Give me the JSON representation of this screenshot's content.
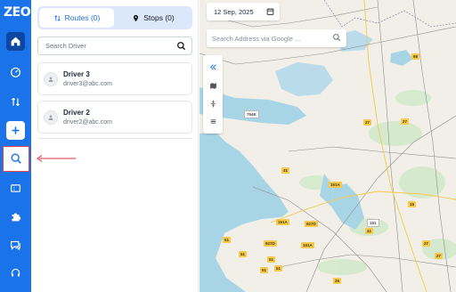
{
  "app": {
    "logo": "ZEO"
  },
  "sidebar": {
    "items": [
      {
        "name": "home",
        "icon": "home-icon"
      },
      {
        "name": "dashboard",
        "icon": "gauge-icon"
      },
      {
        "name": "routes",
        "icon": "route-icon"
      },
      {
        "name": "add",
        "icon": "plus-icon"
      },
      {
        "name": "search",
        "icon": "search-icon"
      },
      {
        "name": "tickets",
        "icon": "ticket-icon"
      },
      {
        "name": "integrations",
        "icon": "puzzle-icon"
      },
      {
        "name": "messages",
        "icon": "chat-icon"
      },
      {
        "name": "support",
        "icon": "headset-icon"
      }
    ]
  },
  "panel": {
    "tabs": [
      {
        "label": "Routes (0)",
        "icon": "route-icon",
        "active": true
      },
      {
        "label": "Stops (0)",
        "icon": "pin-icon",
        "active": false
      }
    ],
    "search_placeholder": "Search Driver",
    "drivers": [
      {
        "name": "Driver 3",
        "email": "driver3@abc.com"
      },
      {
        "name": "Driver 2",
        "email": "driver2@abc.com"
      }
    ]
  },
  "map": {
    "date": "12 Sep, 2025",
    "address_placeholder": "Search Address via Google ...",
    "road_labels": [
      "754K",
      "27",
      "27",
      "41",
      "151A",
      "15",
      "151A",
      "927D",
      "51",
      "51",
      "927D",
      "151A",
      "41",
      "51",
      "51",
      "51",
      "25",
      "27",
      "27",
      "68",
      "151"
    ]
  },
  "colors": {
    "accent": "#1a73e8",
    "sea": "#a8d5e5",
    "land": "#f1efe7",
    "highway": "#f6c94c"
  }
}
